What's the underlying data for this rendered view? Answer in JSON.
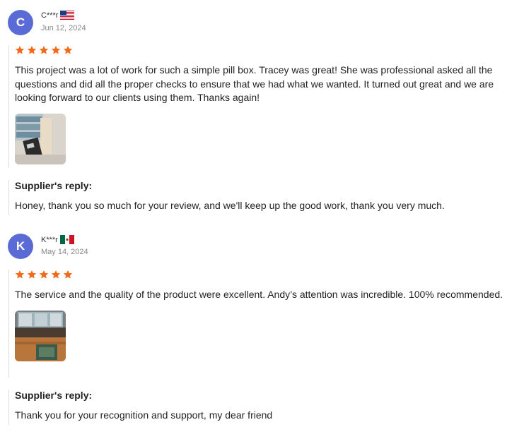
{
  "reviews": [
    {
      "avatar_letter": "C",
      "name": "C***r",
      "flag": "us-flag-icon",
      "date": "Jun 12, 2024",
      "rating": 5,
      "text": "This project was a lot of work for such a simple pill box. Tracey was great! She was professional asked all the questions and did all the proper checks to ensure that we had what we wanted. It turned out great and we are looking forward to our clients using them. Thanks again!",
      "reply_title": "Supplier's reply:",
      "reply_text": "Honey, thank you so much for your review, and we'll keep up the good work, thank you very much."
    },
    {
      "avatar_letter": "K",
      "name": "K***r",
      "flag": "mexico-flag-icon",
      "date": "May 14, 2024",
      "rating": 5,
      "text": "The service and the quality of the product were excellent. Andy’s attention was incredible. 100% recommended.",
      "reply_title": "Supplier's reply:",
      "reply_text": "Thank you for your recognition and support, my dear friend"
    }
  ],
  "colors": {
    "avatar": "#5b6bd6",
    "star": "#f26b1d",
    "divider": "#dcdcdc"
  }
}
